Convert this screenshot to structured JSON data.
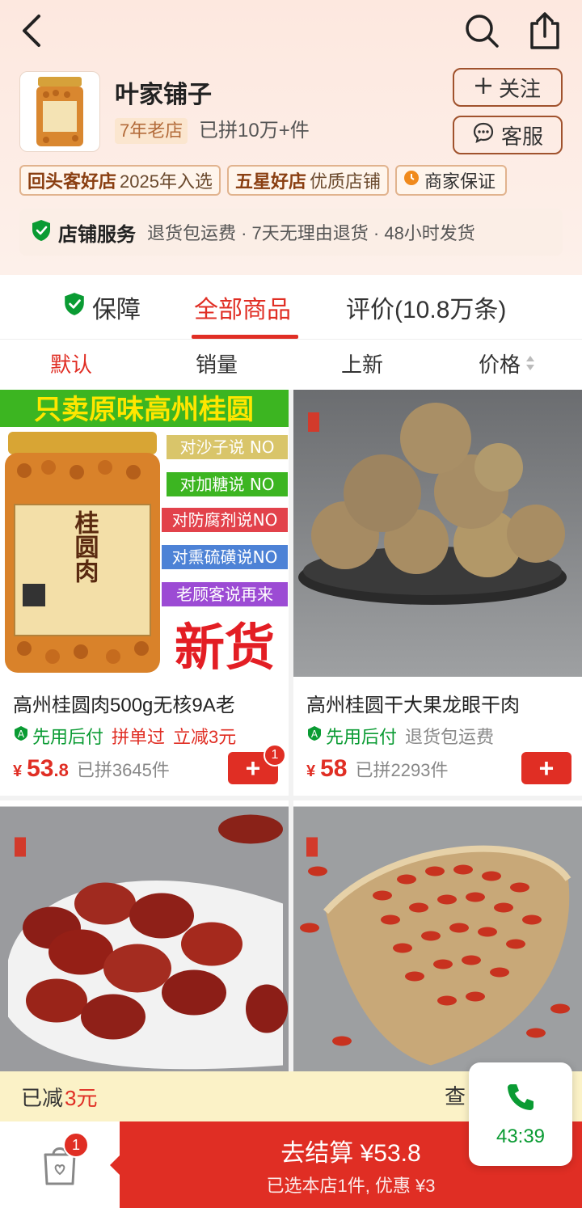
{
  "header": {
    "shop_name": "叶家铺子",
    "years_badge": "7年老店",
    "group_count": "已拼10万+件",
    "follow_label": "关注",
    "service_label": "客服",
    "tags": [
      {
        "strong": "回头客好店",
        "text": "2025年入选"
      },
      {
        "strong": "五星好店",
        "text": "优质店铺"
      },
      {
        "strong": "商家保证",
        "text": ""
      }
    ],
    "service_title": "店铺服务",
    "service_desc": "退货包运费 · 7天无理由退货 · 48小时发货"
  },
  "tabs": [
    {
      "label": "保障"
    },
    {
      "label": "全部商品"
    },
    {
      "label": "评价(10.8万条)"
    }
  ],
  "sorts": [
    "默认",
    "销量",
    "上新",
    "价格"
  ],
  "products": [
    {
      "title": "高州桂圆肉500g无核9A老",
      "tag_green": "先用后付",
      "tag_red_1": "拼单过",
      "tag_red_2": "立减3元",
      "price_int": "53",
      "price_dec": ".8",
      "sold": "已拼3645件",
      "badge": "1",
      "image_texts": {
        "banner": "只卖原味高州桂圆",
        "jar_label": "桂圆肉",
        "tags": [
          "对沙子说 NO",
          "对加糖说 NO",
          "对防腐剂说NO",
          "对熏硫磺说NO",
          "老顾客说再来"
        ],
        "big": "新货"
      }
    },
    {
      "title": "高州桂圆干大果龙眼干肉",
      "tag_green": "先用后付",
      "tag_gray": "退货包运费",
      "price_int": "58",
      "price_dec": "",
      "sold": "已拼2293件"
    }
  ],
  "promo": {
    "text": "已减",
    "amount": "3元",
    "view": "查"
  },
  "cart_badge": "1",
  "checkout": {
    "main": "去结算 ¥53.8",
    "sub": "已选本店1件, 优惠 ¥3"
  },
  "call": {
    "time": "43:39"
  },
  "colors": {
    "accent": "#e02e24",
    "green": "#0a9b33"
  }
}
